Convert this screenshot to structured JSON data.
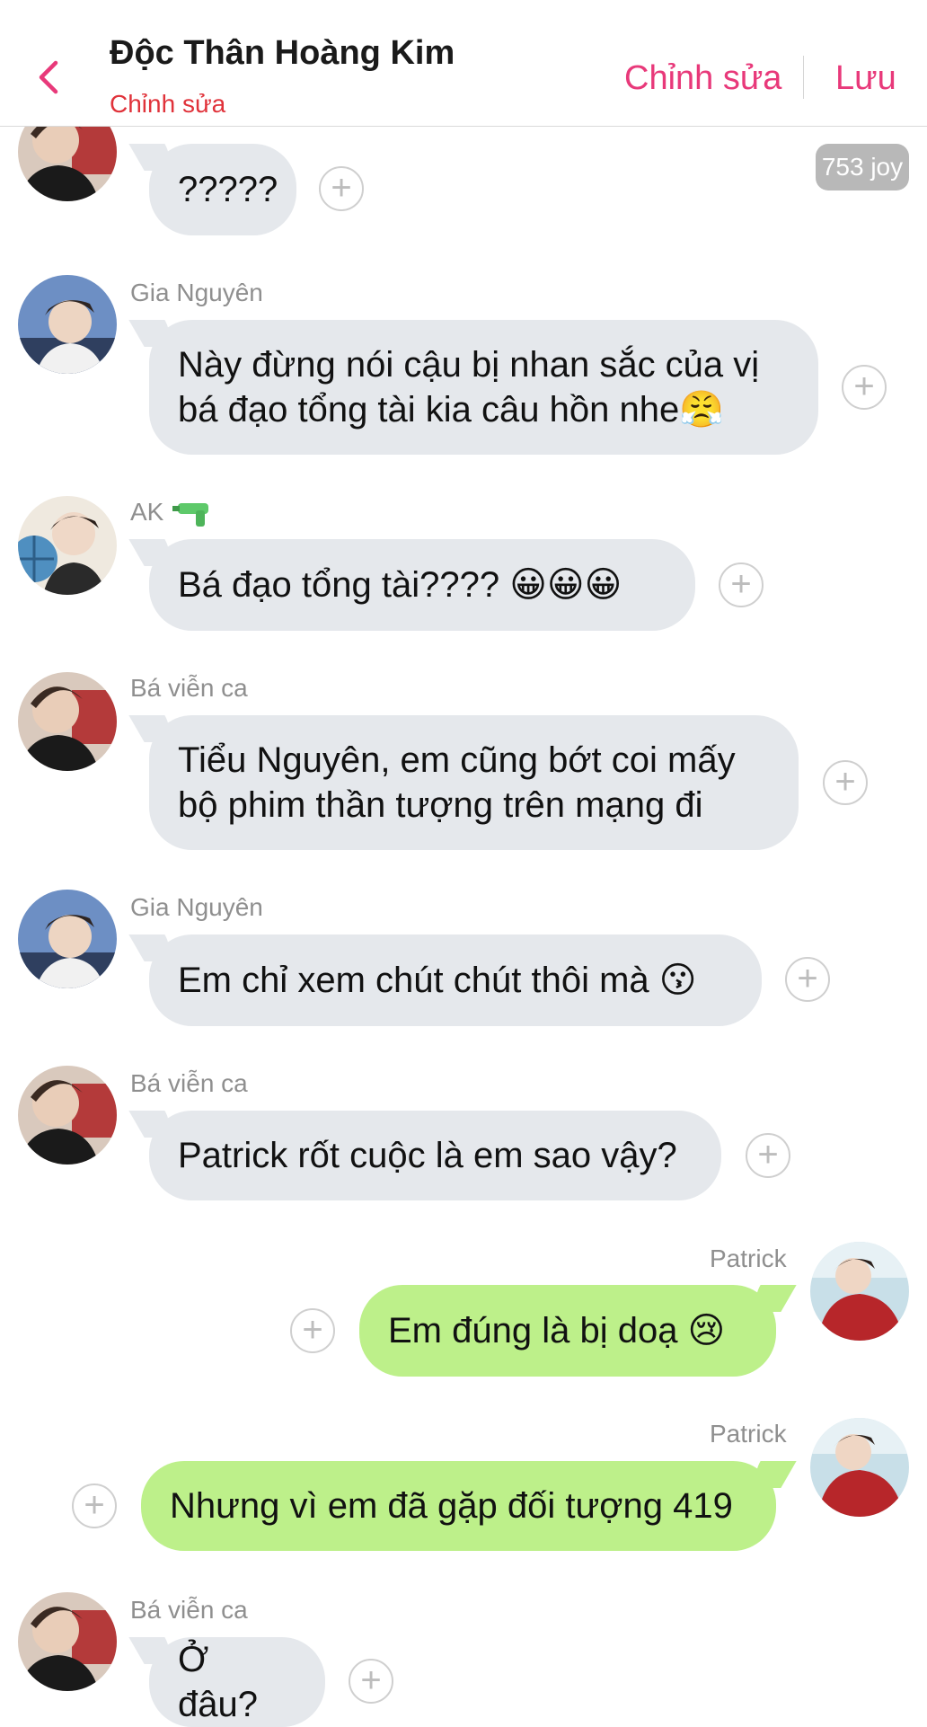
{
  "header": {
    "title": "Độc Thân Hoàng Kim",
    "subtitle": "Chỉnh sửa",
    "edit_label": "Chỉnh sửa",
    "save_label": "Lưu",
    "accent_color": "#e8397a",
    "subtitle_color": "#e0323a"
  },
  "badge": {
    "text": "753 joy"
  },
  "messages": [
    {
      "sender": "",
      "text": "?????",
      "side": "in",
      "avatar": "avatar-ba-vien-ca"
    },
    {
      "sender": "Gia Nguyên",
      "text": "Này đừng nói cậu bị nhan sắc của vị\nbá đạo tổng tài kia câu hồn nhe😤",
      "side": "in",
      "avatar": "avatar-gia-nguyen"
    },
    {
      "sender": "AK",
      "sender_icon": "water-pistol-icon",
      "text": "Bá đạo tổng tài???? 😀😀😀",
      "side": "in",
      "avatar": "avatar-ak"
    },
    {
      "sender": "Bá viễn ca",
      "text": "Tiểu Nguyên, em cũng bớt coi mấy\nbộ phim thần tượng trên mạng đi",
      "side": "in",
      "avatar": "avatar-ba-vien-ca"
    },
    {
      "sender": "Gia Nguyên",
      "text": "Em chỉ xem chút chút thôi mà 😗",
      "side": "in",
      "avatar": "avatar-gia-nguyen"
    },
    {
      "sender": "Bá viễn ca",
      "text": "Patrick rốt cuộc là em sao vậy?",
      "side": "in",
      "avatar": "avatar-ba-vien-ca"
    },
    {
      "sender": "Patrick",
      "text": "Em đúng là bị doạ 😢",
      "side": "out",
      "avatar": "avatar-patrick"
    },
    {
      "sender": "Patrick",
      "text": "Nhưng vì em đã gặp đối tượng 419",
      "side": "out",
      "avatar": "avatar-patrick"
    },
    {
      "sender": "Bá viễn ca",
      "text": "Ở đâu?",
      "side": "in",
      "avatar": "avatar-ba-vien-ca"
    }
  ],
  "plus_symbol": "+",
  "colors": {
    "bubble_in": "#e5e8ec",
    "bubble_out": "#bdf08a",
    "sender_text": "#8f8f8f"
  }
}
